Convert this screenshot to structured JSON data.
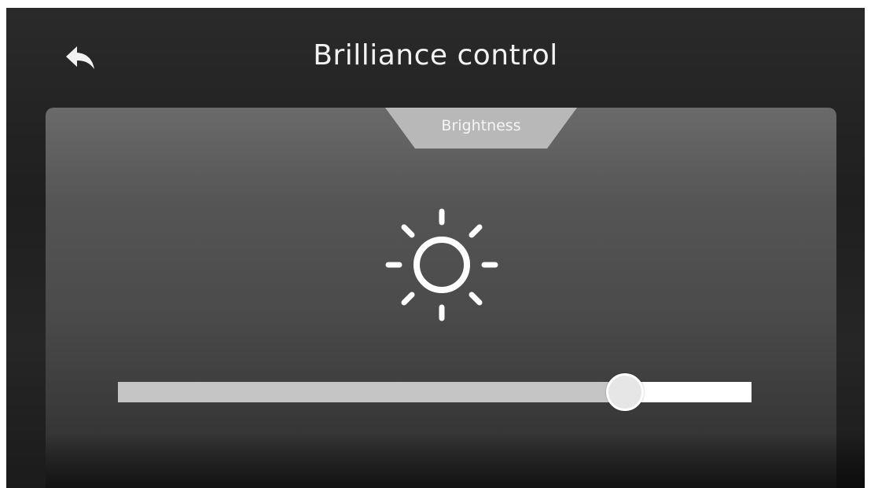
{
  "header": {
    "title": "Brilliance control",
    "back_icon": "back-arrow-icon"
  },
  "panel": {
    "tab_label": "Brightness",
    "icon": "sun-brightness-icon"
  },
  "slider": {
    "value_fraction": 0.8,
    "fill_color": "#c5c5c5",
    "track_color": "#ffffff"
  }
}
